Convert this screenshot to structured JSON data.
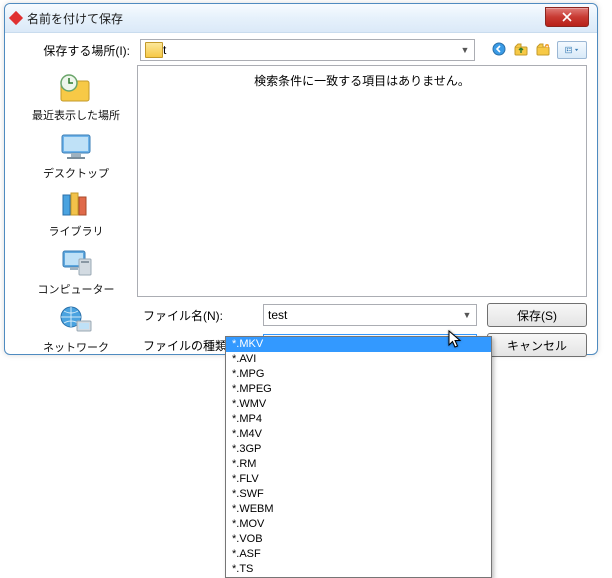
{
  "title": "名前を付けて保存",
  "location": {
    "label": "保存する場所(I):",
    "value": " t"
  },
  "toolbar_icons": [
    "back-icon",
    "up-folder-icon",
    "new-folder-icon",
    "view-menu-icon"
  ],
  "empty_message": "検索条件に一致する項目はありません。",
  "places": [
    {
      "id": "recent",
      "label": "最近表示した場所"
    },
    {
      "id": "desktop",
      "label": "デスクトップ"
    },
    {
      "id": "libraries",
      "label": "ライブラリ"
    },
    {
      "id": "computer",
      "label": "コンピューター"
    },
    {
      "id": "network",
      "label": "ネットワーク"
    }
  ],
  "filename": {
    "label": "ファイル名(N):",
    "value": "test"
  },
  "filetype": {
    "label": "ファイルの種類(T):",
    "value": "*.MKV",
    "options": [
      "*.MKV",
      "*.AVI",
      "*.MPG",
      "*.MPEG",
      "*.WMV",
      "*.MP4",
      "*.M4V",
      "*.3GP",
      "*.RM",
      "*.FLV",
      "*.SWF",
      "*.WEBM",
      "*.MOV",
      "*.VOB",
      "*.ASF",
      "*.TS"
    ],
    "selected_index": 0
  },
  "buttons": {
    "save": "保存(S)",
    "cancel": "キャンセル"
  }
}
